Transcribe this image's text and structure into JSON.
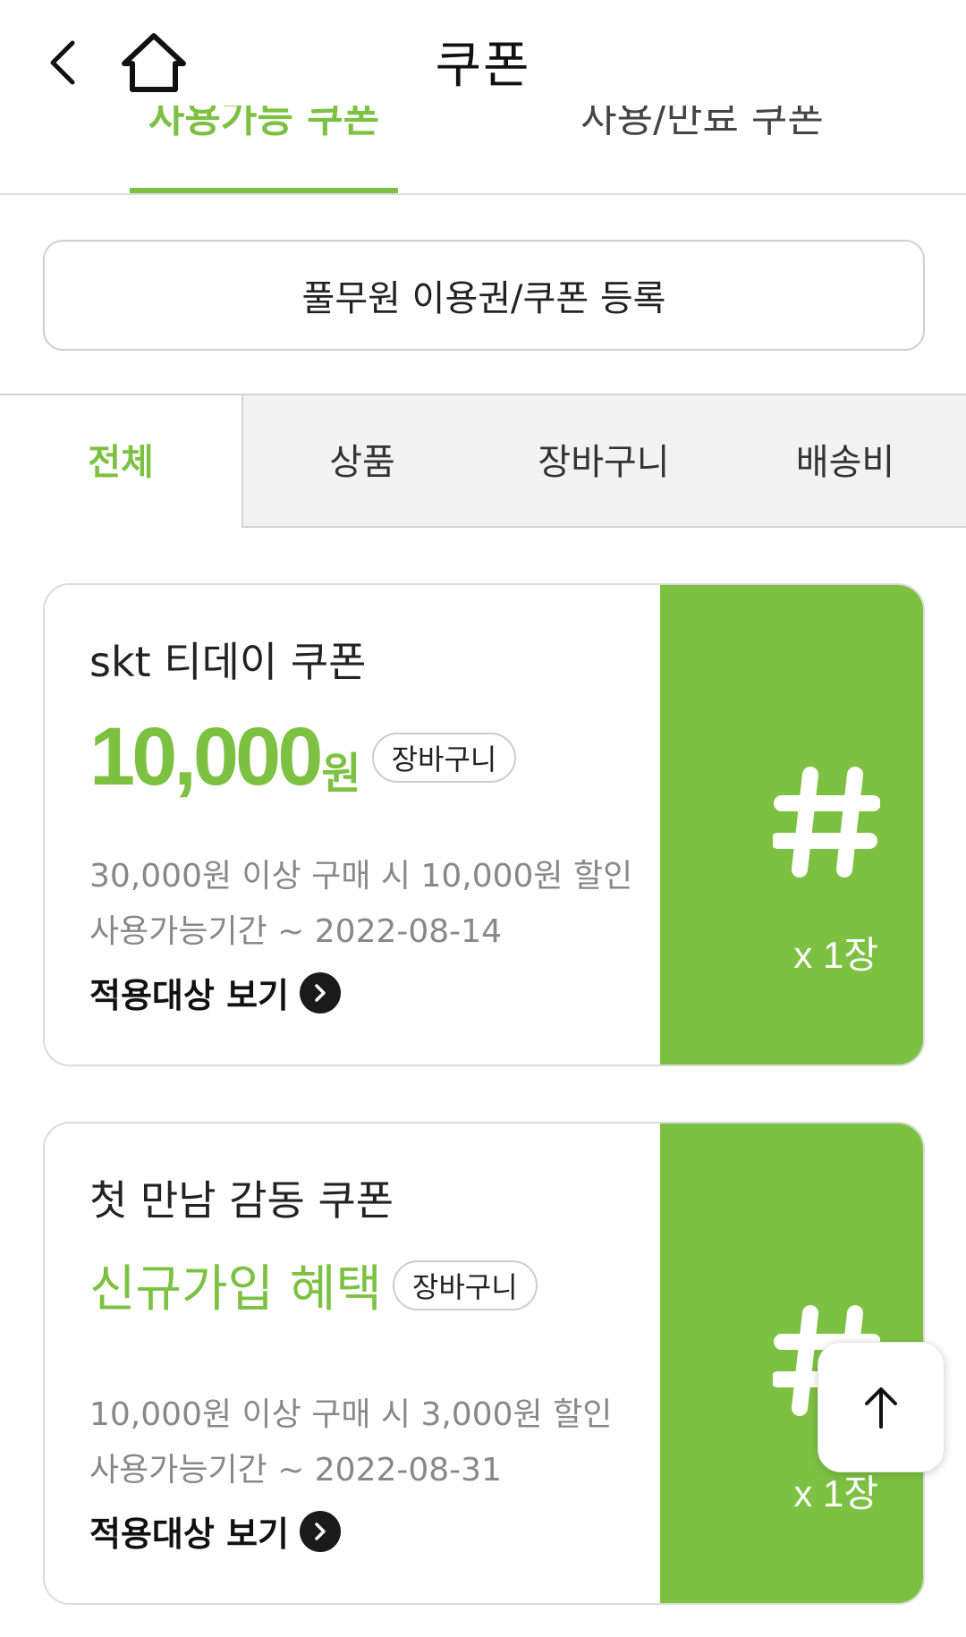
{
  "header": {
    "title": "쿠폰",
    "back_icon": "chevron-left-icon",
    "home_icon": "home-icon"
  },
  "top_tabs": [
    {
      "label": "사용가능 쿠폰",
      "active": true
    },
    {
      "label": "사용/만료 쿠폰",
      "active": false
    }
  ],
  "register_button": {
    "label": "풀무원 이용권/쿠폰 등록"
  },
  "filter_tabs": [
    {
      "label": "전체",
      "active": true
    },
    {
      "label": "상품",
      "active": false
    },
    {
      "label": "장바구니",
      "active": false
    },
    {
      "label": "배송비",
      "active": false
    }
  ],
  "coupons": [
    {
      "name": "skt 티데이 쿠폰",
      "amount": "10,000",
      "amount_unit": "원",
      "badge": "장바구니",
      "condition": "30,000원 이상 구매 시 10,000원 할인",
      "period": "사용가능기간 ~ 2022-08-14",
      "target_label": "적용대상 보기",
      "count": "x 1장"
    },
    {
      "name": "첫 만남 감동 쿠폰",
      "benefit": "신규가입 혜택",
      "badge": "장바구니",
      "condition": "10,000원 이상 구매 시 3,000원 할인",
      "period": "사용가능기간 ~ 2022-08-31",
      "target_label": "적용대상 보기",
      "count": "x 1장"
    }
  ],
  "scroll_top": {
    "icon": "arrow-up-icon"
  },
  "colors": {
    "accent": "#7dc142",
    "text": "#222222",
    "muted": "#888888",
    "tab_bg": "#f2f2f2"
  }
}
